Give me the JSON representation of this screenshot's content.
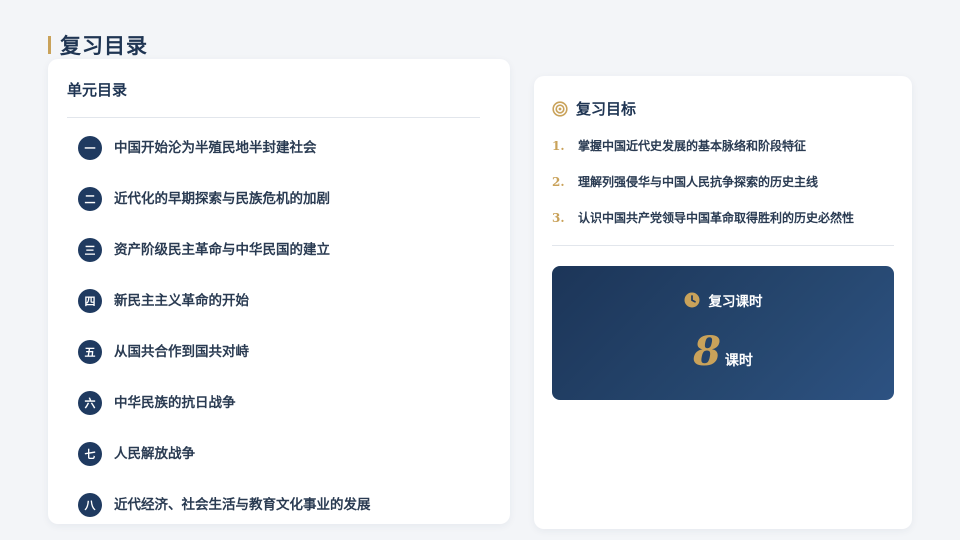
{
  "page": {
    "title": "复习目录"
  },
  "units": {
    "heading": "单元目录",
    "items": [
      {
        "num": "一",
        "label": "中国开始沦为半殖民地半封建社会"
      },
      {
        "num": "二",
        "label": "近代化的早期探索与民族危机的加剧"
      },
      {
        "num": "三",
        "label": "资产阶级民主革命与中华民国的建立"
      },
      {
        "num": "四",
        "label": "新民主主义革命的开始"
      },
      {
        "num": "五",
        "label": "从国共合作到国共对峙"
      },
      {
        "num": "六",
        "label": "中华民族的抗日战争"
      },
      {
        "num": "七",
        "label": "人民解放战争"
      },
      {
        "num": "八",
        "label": "近代经济、社会生活与教育文化事业的发展"
      }
    ]
  },
  "goals": {
    "title": "复习目标",
    "items": [
      {
        "index": "1.",
        "text": "掌握中国近代史发展的基本脉络和阶段特征"
      },
      {
        "index": "2.",
        "text": "理解列强侵华与中国人民抗争探索的历史主线"
      },
      {
        "index": "3.",
        "text": "认识中国共产党领导中国革命取得胜利的历史必然性"
      }
    ]
  },
  "hours": {
    "title": "复习课时",
    "value": "8",
    "unit": "课时"
  },
  "icons": {
    "goal_icon": "target-icon",
    "hours_icon": "clock-icon"
  },
  "colors": {
    "navy": "#1f3a60",
    "gold": "#c9a25a",
    "background": "#f3f5f8"
  }
}
